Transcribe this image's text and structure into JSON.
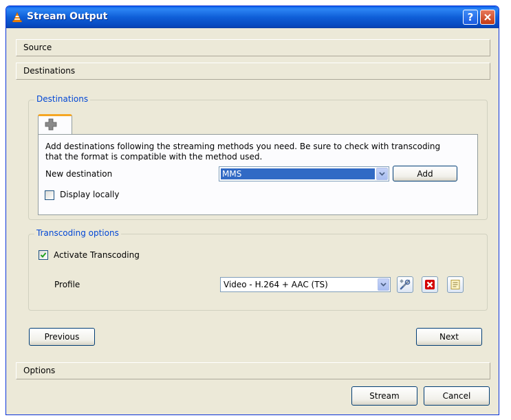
{
  "window": {
    "title": "Stream Output"
  },
  "sections": {
    "source": "Source",
    "destinations": "Destinations",
    "options": "Options"
  },
  "destinations_group": {
    "legend": "Destinations",
    "description": "Add destinations following the streaming methods you need. Be sure to check with transcoding that the format is compatible with the method used.",
    "new_destination_label": "New destination",
    "method_selected": "MMS",
    "add_label": "Add",
    "display_locally_label": "Display locally",
    "display_locally_checked": false
  },
  "transcoding_group": {
    "legend": "Transcoding options",
    "activate_label": "Activate Transcoding",
    "activate_checked": true,
    "profile_label": "Profile",
    "profile_selected": "Video - H.264 + AAC (TS)"
  },
  "nav": {
    "previous_label": "Previous",
    "next_label": "Next"
  },
  "footer": {
    "stream_label": "Stream",
    "cancel_label": "Cancel"
  },
  "icons": {
    "app": "vlc-cone-icon",
    "help": "help-icon",
    "close": "close-icon",
    "add_tab": "plus-icon",
    "edit_profile": "tools-icon",
    "delete_profile": "delete-icon",
    "new_profile": "new-profile-icon"
  },
  "colors": {
    "titlebar": "#0a5ee8",
    "accent_text": "#0046d5",
    "selection": "#316ac5",
    "tab_highlight": "#f5a623",
    "delete_red": "#d40000"
  }
}
